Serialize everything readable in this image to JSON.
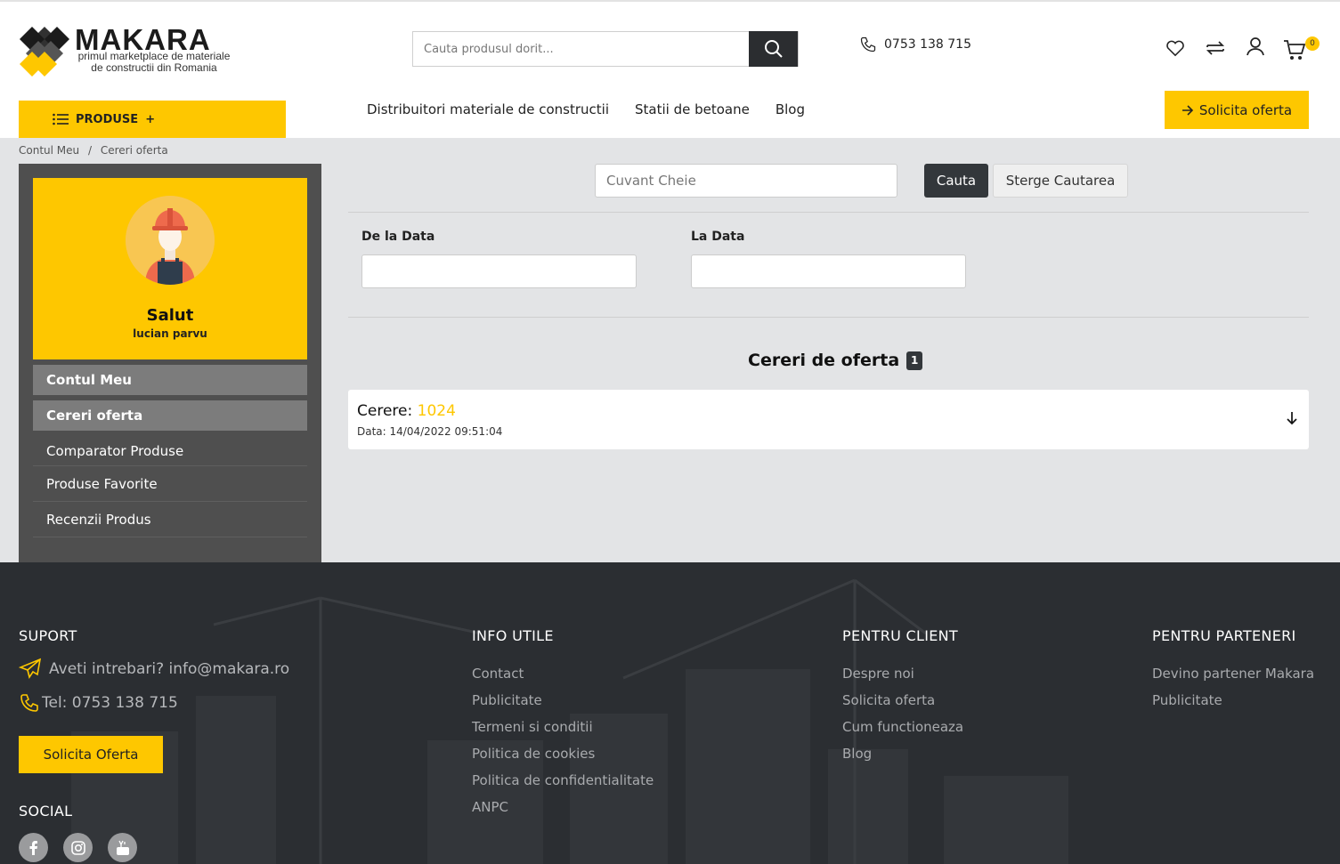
{
  "header": {
    "logo_name": "MAKARA",
    "logo_tagline_1": "primul marketplace de materiale",
    "logo_tagline_2": "de constructii din Romania",
    "search_placeholder": "Cauta produsul dorit...",
    "phone": "0753 138 715",
    "cart_count": "0",
    "icons": [
      "search-icon",
      "phone-icon",
      "heart-icon",
      "compare-icon",
      "user-icon",
      "cart-icon"
    ],
    "produse_label": "PRODUSE",
    "produse_plus": "+",
    "nav": [
      "Distribuitori materiale de constructii",
      "Statii de betoane",
      "Blog"
    ],
    "solicita_label": "Solicita oferta"
  },
  "breadcrumb": {
    "items": [
      "Contul Meu",
      "Cereri oferta"
    ],
    "separator": "/"
  },
  "sidebar": {
    "greeting": "Salut",
    "username": "lucian parvu",
    "menu": [
      "Contul Meu",
      "Cereri oferta",
      "Comparator Produse",
      "Produse Favorite",
      "Recenzii Produs"
    ]
  },
  "filters": {
    "keyword_placeholder": "Cuvant Cheie",
    "search_button": "Cauta",
    "clear_button": "Sterge Cautarea",
    "from_label": "De la Data",
    "to_label": "La Data"
  },
  "requests": {
    "title": "Cereri de oferta",
    "count": "1",
    "items": [
      {
        "label": "Cerere:",
        "id": "1024",
        "date": "Data: 14/04/2022 09:51:04"
      }
    ]
  },
  "footer": {
    "suport": {
      "title": "SUPORT",
      "email_text": "Aveti intrebari? info@makara.ro",
      "phone_text": "Tel: 0753 138 715",
      "button": "Solicita Oferta"
    },
    "social": {
      "title": "SOCIAL",
      "icons": [
        "facebook-icon",
        "instagram-icon",
        "youtube-icon"
      ]
    },
    "info": {
      "title": "INFO UTILE",
      "links": [
        "Contact",
        "Publicitate",
        "Termeni si conditii",
        "Politica de cookies",
        "Politica de confidentialitate",
        "ANPC"
      ]
    },
    "client": {
      "title": "PENTRU CLIENT",
      "links": [
        "Despre noi",
        "Solicita oferta",
        "Cum functioneaza",
        "Blog"
      ]
    },
    "partners": {
      "title": "PENTRU PARTENERI",
      "links": [
        "Devino partener Makara",
        "Publicitate"
      ]
    }
  },
  "colors": {
    "accent": "#fec700",
    "dark": "#33373b",
    "footer_bg": "#2b2e32",
    "sidebar_bg": "#4f4f4f",
    "main_bg": "#e3e4e6"
  }
}
